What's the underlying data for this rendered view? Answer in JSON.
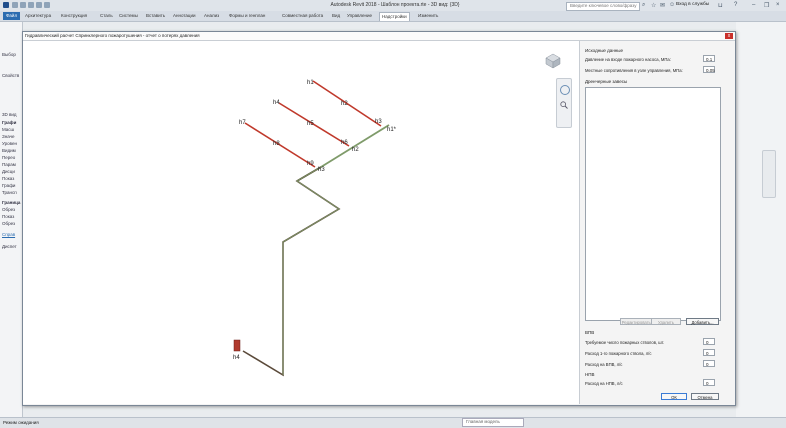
{
  "app": {
    "title": "Autodesk Revit 2018 - Шаблон проекта.rte - 3D вид: {3D}",
    "search_placeholder": "Введите ключевое слово/фразу",
    "signin": "Вход в службы"
  },
  "ribbon": {
    "tabs": [
      "Файл",
      "Архитектура",
      "Конструкция",
      "Сталь",
      "Системы",
      "Вставить",
      "Аннотации",
      "Анализ",
      "Формы и генплан",
      "Совместная работа",
      "Вид",
      "Управление",
      "Надстройки",
      "Изменить"
    ],
    "active_index": 12
  },
  "left_panel": {
    "items": [
      "Выбор",
      "Свойств",
      "3D вид",
      "Графи",
      "Масш",
      "Значе",
      "Уровен",
      "Видим",
      "Перео",
      "Парам",
      "Дисци",
      "Показ",
      "Графи",
      "Трансп",
      "Граница",
      "Обрез",
      "Показ",
      "Обрез",
      "Справ",
      "Диспет"
    ]
  },
  "status": {
    "text": "Режим ожидания",
    "model": "Главная модель"
  },
  "dialog": {
    "title": "Гидравлический расчет Спринклерного пожаротушения - отчет о потерях давления",
    "close": "x",
    "sections": {
      "initial": "Исходные данные",
      "drain": "Дренчерные завесы",
      "vpv": "ВПВ",
      "npv": "НПВ"
    },
    "fields": {
      "inlet_pressure": {
        "label": "Давление на входе пожарного насоса, МПа:",
        "value": "0.1"
      },
      "local_resistance": {
        "label": "Местные сопротивления в узле управления, МПа:",
        "value": "0.05"
      },
      "hydrants_required": {
        "label": "Требуемое число пожарных стволов, шт.",
        "value": "0"
      },
      "hydrant_flow": {
        "label": "Расход 1-го пожарного ствола, л/с",
        "value": "0"
      },
      "vpv_flow": {
        "label": "Расход на ВПВ, л/с",
        "value": "0"
      },
      "npv_flow": {
        "label": "Расход на НПВ, л/с",
        "value": "0"
      }
    },
    "buttons": {
      "edit": "Редактировать...",
      "delete": "Удалить",
      "add": "Добавить...",
      "ok": "ОК",
      "cancel": "Отмена"
    },
    "node_labels": [
      "h1",
      "h2",
      "h3",
      "h1*",
      "h4",
      "h5",
      "h6",
      "h2",
      "h7",
      "h8",
      "h9",
      "h3",
      "h4"
    ]
  },
  "colors": {
    "pipe_red": "#c0392b",
    "pipe_green": "#7f9b6a",
    "pipe_dark": "#5b4a3a",
    "accent": "#2b6cb0"
  }
}
